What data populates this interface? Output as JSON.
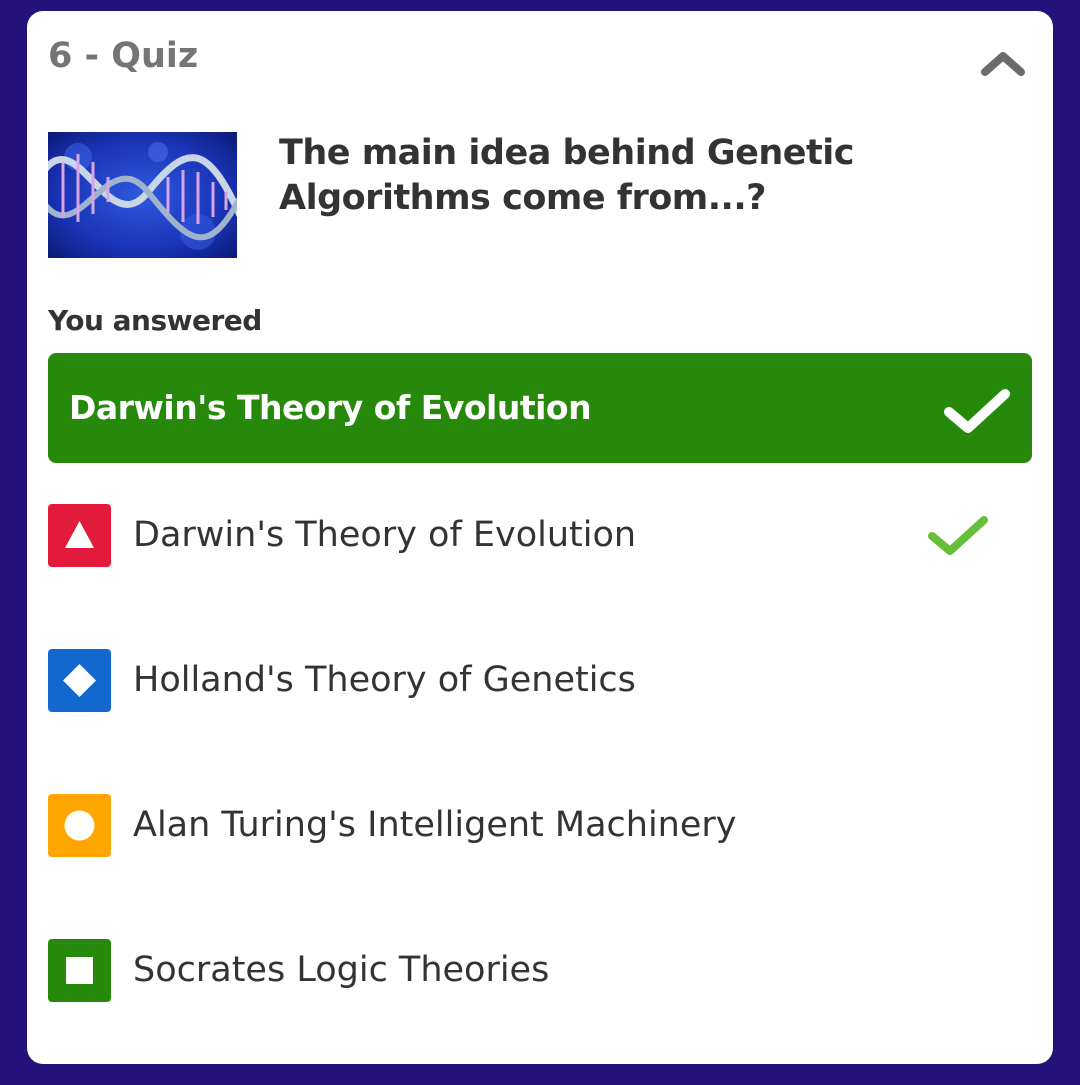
{
  "card": {
    "title": "6 - Quiz"
  },
  "question": {
    "text": "The main idea behind Genetic Algorithms come from...?",
    "image_icon": "dna-helix-image"
  },
  "answered": {
    "label": "You answered",
    "answer": "Darwin's Theory of Evolution",
    "correct": true
  },
  "options": [
    {
      "label": "Darwin's Theory of Evolution",
      "shape": "triangle",
      "color": "#e21b3c",
      "correct": true
    },
    {
      "label": "Holland's Theory of Genetics",
      "shape": "diamond",
      "color": "#1368ce",
      "correct": false
    },
    {
      "label": "Alan Turing's Intelligent Machinery",
      "shape": "circle",
      "color": "#ffa602",
      "correct": false
    },
    {
      "label": "Socrates Logic Theories",
      "shape": "square",
      "color": "#26890c",
      "correct": false
    }
  ],
  "colors": {
    "background": "#24127a",
    "correct_green": "#26890c",
    "check_green": "#66bf39"
  }
}
